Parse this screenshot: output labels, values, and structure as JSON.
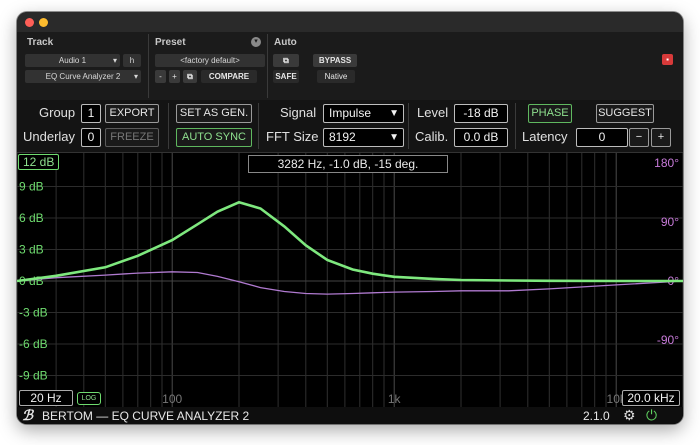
{
  "window": {
    "traffic_lights": [
      "#ff5f57",
      "#febc2e"
    ]
  },
  "host": {
    "track_label": "Track",
    "preset_label": "Preset",
    "auto_label": "Auto",
    "track_name": "Audio 1",
    "track_suffix": "h",
    "insert_name": "EQ Curve Analyzer 2",
    "preset_value": "<factory default>",
    "minus": "-",
    "plus": "+",
    "compare": "COMPARE",
    "safe": "SAFE",
    "bypass": "BYPASS",
    "native": "Native"
  },
  "controls": {
    "group_label": "Group",
    "group_value": "1",
    "export": "EXPORT",
    "underlay_label": "Underlay",
    "underlay_value": "0",
    "freeze": "FREEZE",
    "set_as_gen": "SET AS GEN.",
    "auto_sync": "AUTO SYNC",
    "signal_label": "Signal",
    "signal_value": "Impulse",
    "fft_label": "FFT Size",
    "fft_value": "8192",
    "level_label": "Level",
    "level_value": "-18 dB",
    "calib_label": "Calib.",
    "calib_value": "0.0 dB",
    "phase": "PHASE",
    "suggest": "SUGGEST",
    "latency_label": "Latency",
    "latency_value": "0",
    "latency_minus": "−",
    "latency_plus": "+"
  },
  "graph": {
    "range_top": "12 dB",
    "readout": "3282 Hz, -1.0 dB, -15 deg.",
    "db_labels": [
      "9 dB",
      "6 dB",
      "3 dB",
      "0 dB",
      "-3 dB",
      "-6 dB",
      "-9 dB"
    ],
    "deg_labels": [
      "180°",
      "90°",
      "0°",
      "-90°"
    ],
    "freq_labels": [
      "100",
      "1k",
      "10k"
    ],
    "freq_min": "20 Hz",
    "freq_max": "20.0 kHz",
    "log": "LOG",
    "colors": {
      "magnitude": "#7ee87e",
      "phase": "#b07ad0",
      "db_text": "#6fdc6f",
      "deg_text": "#c77ad9"
    }
  },
  "chart_data": {
    "type": "line",
    "xscale": "log",
    "xlim": [
      20,
      20000
    ],
    "ylim": [
      -12,
      12
    ],
    "y2lim": [
      -180,
      180
    ],
    "series": [
      {
        "axis": "dB",
        "x": [
          20,
          30,
          50,
          70,
          100,
          130,
          160,
          200,
          250,
          320,
          400,
          500,
          650,
          800,
          1000,
          1500,
          2000,
          3282,
          5000,
          10000,
          20000
        ],
        "y": [
          0,
          0.5,
          1.3,
          2.4,
          3.9,
          5.4,
          6.6,
          7.5,
          6.9,
          5.2,
          3.4,
          2.0,
          1.1,
          0.7,
          0.4,
          0.2,
          0.1,
          0.05,
          0.02,
          0,
          0
        ]
      },
      {
        "axis": "deg",
        "x": [
          20,
          30,
          50,
          70,
          100,
          130,
          160,
          200,
          250,
          320,
          400,
          500,
          650,
          800,
          1000,
          1500,
          2000,
          3282,
          5000,
          10000,
          20000
        ],
        "y": [
          0,
          5,
          9,
          12,
          14,
          13,
          7,
          -1,
          -10,
          -16,
          -19,
          -20,
          -19,
          -18,
          -17,
          -16,
          -15,
          -15,
          -12,
          -6,
          0
        ]
      }
    ]
  },
  "footer": {
    "brand": "BERTOM — EQ CURVE ANALYZER 2",
    "version": "2.1.0"
  }
}
